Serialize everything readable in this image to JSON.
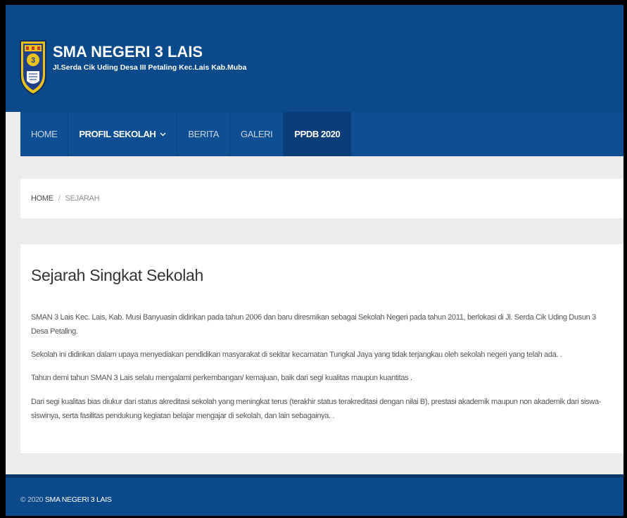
{
  "header": {
    "title": "SMA NEGERI 3 LAIS",
    "address": "Jl.Serda Cik Uding Desa III Petaling Kec.Lais Kab.Muba",
    "logo_icon": "school-crest-icon"
  },
  "nav": {
    "items": [
      {
        "label": "HOME"
      },
      {
        "label": "PROFIL SEKOLAH"
      },
      {
        "label": "BERITA"
      },
      {
        "label": "GALERI"
      },
      {
        "label": "PPDB 2020"
      }
    ],
    "dropdown_icon": "chevron-down-icon"
  },
  "breadcrumb": {
    "home": "HOME",
    "separator": "/",
    "current": "SEJARAH"
  },
  "content": {
    "heading": "Sejarah Singkat Sekolah",
    "paragraphs": [
      "SMAN 3 Lais Kec. Lais, Kab. Musi Banyuasin didirikan pada tahun 2006 dan baru diresmikan sebagai Sekolah Negeri pada tahun 2011, berlokasi di Jl. Serda Cik Uding Dusun 3 Desa Petaling.",
      "Sekolah ini didirikan dalam upaya menyediakan pendidikan masyarakat di sekitar kecamatan Tungkal Jaya yang tidak terjangkau oleh sekolah negeri yang telah ada. .",
      "Tahun demi tahun SMAN 3 Lais selalu mengalami perkembangan/ kemajuan, baik dari segi kualitas maupun kuantitas .",
      "Dari segi kualitas bias diukur dari status akreditasi sekolah yang meningkat terus (terakhir status terakreditasi dengan nilai B), prestasi akademik maupun non akademik dari siswa-siswinya, serta fasilitas pendukung kegiatan belajar mengajar di sekolah, dan lain sebagainya. ."
    ]
  },
  "footer": {
    "copyright": "© 2020",
    "site_name": "SMA NEGERI 3 LAIS"
  },
  "colors": {
    "header_blue": "#0b4a8a",
    "nav_blue": "#0e4f93",
    "nav_active": "#0b3e78",
    "page_bg": "#ececec"
  }
}
